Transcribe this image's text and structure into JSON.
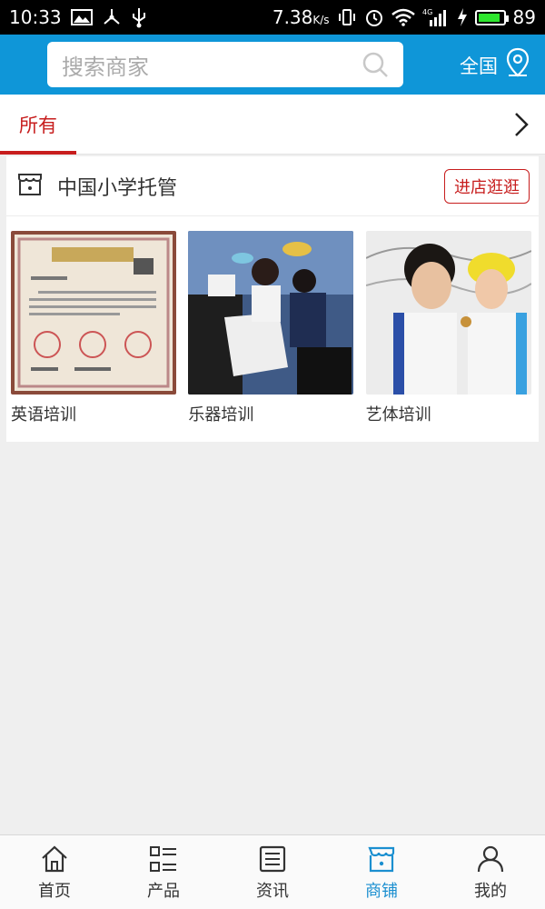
{
  "status_bar": {
    "time": "10:33",
    "speed": "7.38",
    "speed_unit": "K/s",
    "network": "4G",
    "battery": "89",
    "battery_level": 0.89
  },
  "header": {
    "search_placeholder": "搜索商家",
    "region_label": "全国",
    "accent_color": "#0f96d8"
  },
  "tabs": {
    "active_label": "所有",
    "active_color": "#c71d1d"
  },
  "store": {
    "name": "中国小学托管",
    "enter_label": "进店逛逛",
    "items": [
      {
        "caption": "英语培训",
        "image": "certificate-photo"
      },
      {
        "caption": "乐器培训",
        "image": "piano-lesson-photo"
      },
      {
        "caption": "艺体培训",
        "image": "children-photo"
      }
    ]
  },
  "bottom_nav": {
    "items": [
      {
        "label": "首页",
        "icon": "home-icon"
      },
      {
        "label": "产品",
        "icon": "list-icon"
      },
      {
        "label": "资讯",
        "icon": "news-icon"
      },
      {
        "label": "商铺",
        "icon": "shop-icon"
      },
      {
        "label": "我的",
        "icon": "user-icon"
      }
    ],
    "active_index": 3
  }
}
